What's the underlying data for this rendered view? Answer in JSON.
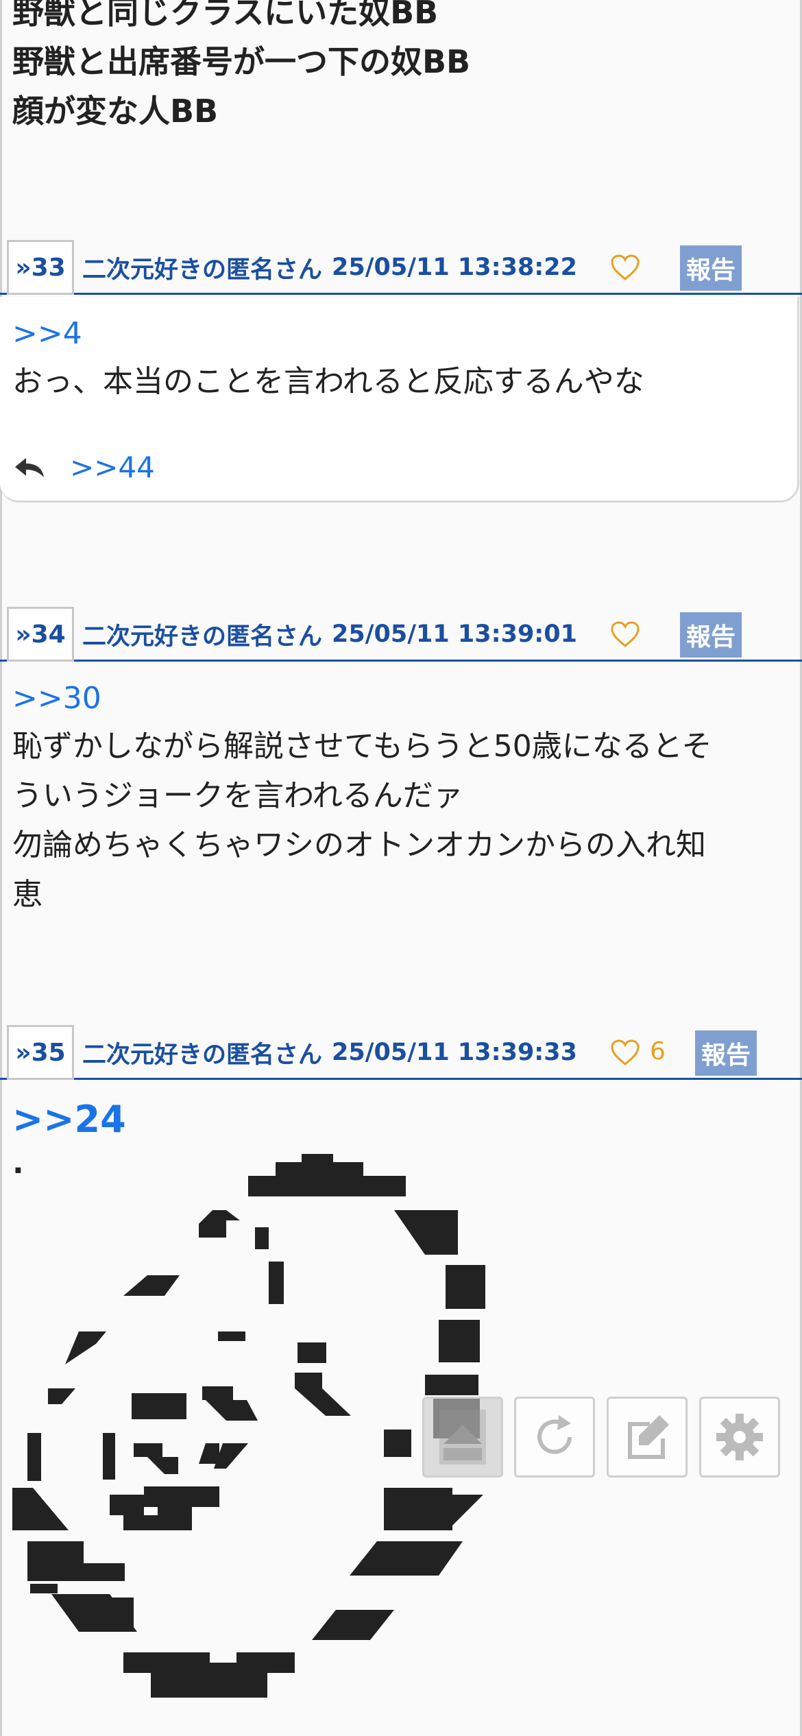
{
  "top_lines": [
    "野獣と同じクラスにいた奴BB",
    "野獣と出席番号が一つ下の奴BB",
    "顔が変な人BB"
  ],
  "posts": [
    {
      "number": "»33",
      "name": "二次元好きの匿名さん",
      "date": "25/05/11 13:38:22",
      "likes": "",
      "report_label": "報告",
      "anchor": ">>4",
      "body": [
        "おっ、本当のことを言われると反応するんやな"
      ],
      "replies": ">>44"
    },
    {
      "number": "»34",
      "name": "二次元好きの匿名さん",
      "date": "25/05/11 13:39:01",
      "likes": "",
      "report_label": "報告",
      "anchor": ">>30",
      "body": [
        "恥ずかしながら解説させてもらうと50歳になるとそ",
        "ういうジョークを言われるんだァ",
        "勿論めちゃくちゃワシのオトンオカンからの入れ知",
        "恵"
      ]
    },
    {
      "number": "»35",
      "name": "二次元好きの匿名さん",
      "date": "25/05/11 13:39:33",
      "likes": "6",
      "report_label": "報告",
      "anchor": ">>24",
      "body_dot": "."
    }
  ],
  "toolbar": {
    "icons": [
      "scroll-top-icon",
      "refresh-icon",
      "edit-icon",
      "settings-icon"
    ]
  },
  "colors": {
    "link_blue": "#1a73e8",
    "header_blue": "#1a4fa0",
    "report_bg": "#7f9fd0",
    "heart": "#e8a020"
  }
}
